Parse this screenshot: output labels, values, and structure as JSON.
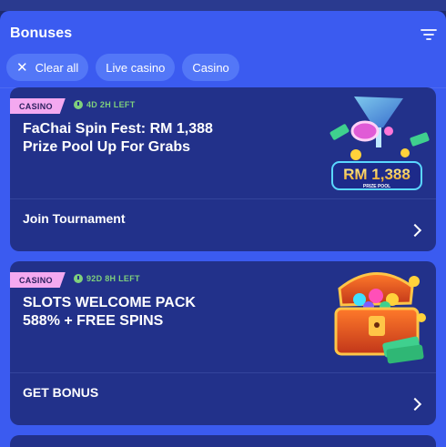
{
  "header": {
    "title": "Bonuses",
    "filter_icon": "filter-icon"
  },
  "chips": [
    {
      "label": "Clear all",
      "icon": "close-icon"
    },
    {
      "label": "Live casino"
    },
    {
      "label": "Casino"
    }
  ],
  "cards": [
    {
      "badge": "CASINO",
      "timer": "4D 2H LEFT",
      "title": "FaChai Spin Fest: RM 1,388 Prize Pool Up For Grabs",
      "cta": "Join Tournament",
      "art": {
        "icon": "prize-pool-art",
        "amount_text": "RM 1,388",
        "caption": "PRIZE POOL"
      }
    },
    {
      "badge": "CASINO",
      "timer": "92D 8H LEFT",
      "title": "SLOTS WELCOME PACK 588% + FREE SPINS",
      "cta": "GET BONUS",
      "art": {
        "icon": "treasure-chest-art"
      }
    }
  ],
  "colors": {
    "panel": "#3b5bf0",
    "card": "#22318a",
    "chip": "#5377f7",
    "badge": "#f4a9f0",
    "timer": "#7fd07c"
  }
}
